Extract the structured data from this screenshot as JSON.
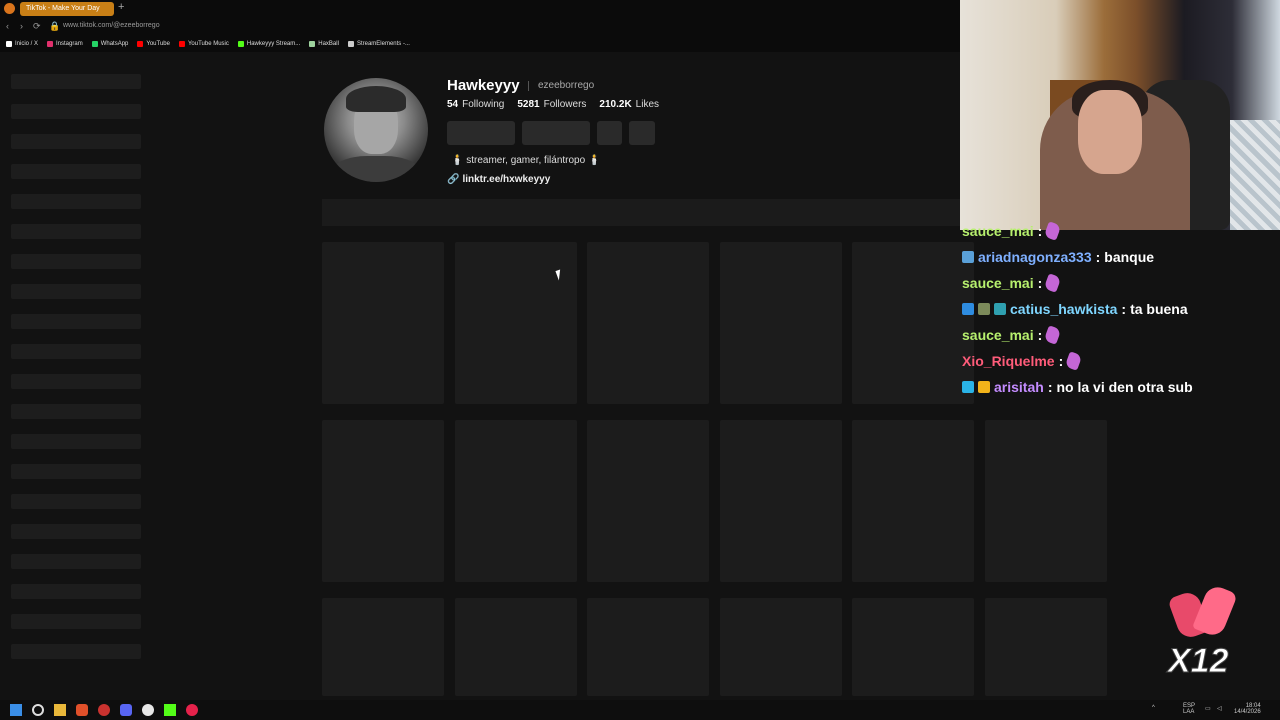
{
  "browser": {
    "tab_title": "TikTok - Make Your Day",
    "new_tab": "+",
    "url": "www.tiktok.com/@ezeeborrego",
    "bookmarks": [
      {
        "label": "Inicio / X",
        "color": "#ffffff"
      },
      {
        "label": "Instagram",
        "color": "#e1306c"
      },
      {
        "label": "WhatsApp",
        "color": "#25d366"
      },
      {
        "label": "YouTube",
        "color": "#ff0000"
      },
      {
        "label": "YouTube Music",
        "color": "#ff0000"
      },
      {
        "label": "Hawkeyyy Stream...",
        "color": "#53fc18"
      },
      {
        "label": "HaxBall",
        "color": "#9ed39e"
      },
      {
        "label": "StreamElements -...",
        "color": "#cccccc"
      }
    ]
  },
  "profile": {
    "username": "Hawkeyyy",
    "handle": "ezeeborrego",
    "following_count": "54",
    "following_label": "Following",
    "followers_count": "5281",
    "followers_label": "Followers",
    "likes_count": "210.2K",
    "likes_label": "Likes",
    "bio": "🕯️ streamer, gamer, filántropo 🕯️",
    "link": "linktr.ee/hxwkeyyy"
  },
  "chat": {
    "messages": [
      {
        "user": "sauce_mai",
        "user_color": "#b7f06e",
        "text": "",
        "emote": true,
        "badges": []
      },
      {
        "user": "ariadnagonza333",
        "user_color": "#7fb0ff",
        "text": "banque",
        "emote": false,
        "badges": [
          "#5aa0d8"
        ]
      },
      {
        "user": "sauce_mai",
        "user_color": "#b7f06e",
        "text": "",
        "emote": true,
        "badges": []
      },
      {
        "user": "catius_hawkista",
        "user_color": "#7fd6ff",
        "text": "ta buena",
        "emote": false,
        "badges": [
          "#2e8ce0",
          "#7c8a5a",
          "#2fa0b0"
        ]
      },
      {
        "user": "sauce_mai",
        "user_color": "#b7f06e",
        "text": "",
        "emote": true,
        "badges": []
      },
      {
        "user": "Xio_Riquelme",
        "user_color": "#ff5c7a",
        "text": "",
        "emote": true,
        "badges": []
      },
      {
        "user": "arisitah",
        "user_color": "#c48cff",
        "text": "no la vi den otra sub",
        "emote": false,
        "badges": [
          "#2ab3e6",
          "#f2b31a"
        ]
      }
    ]
  },
  "overlay": {
    "multiplier": "X12"
  },
  "taskbar": {
    "lang": "ESP",
    "lang_sub": "LAA",
    "time": "18:04",
    "date": "14/4/2026"
  }
}
